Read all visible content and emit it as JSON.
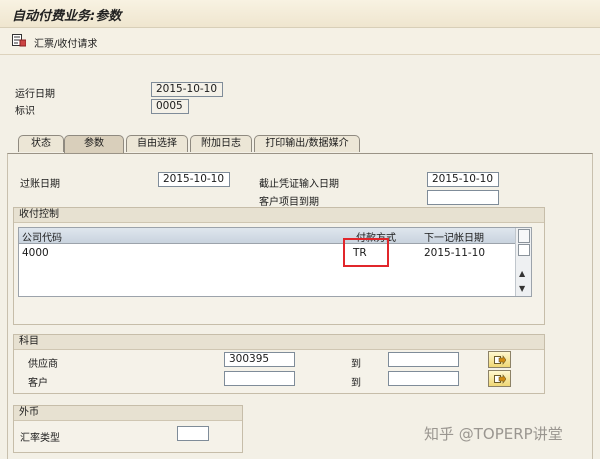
{
  "window": {
    "title": "自动付费业务:参数"
  },
  "toolbar": {
    "items": [
      {
        "icon": "document-list-icon",
        "label": "汇票/收付请求"
      }
    ]
  },
  "header": {
    "run_date_label": "运行日期",
    "run_date_value": "2015-10-10",
    "id_label": "标识",
    "id_value": "0005"
  },
  "tabs": [
    {
      "label": "状态",
      "active": false
    },
    {
      "label": "参数",
      "active": true
    },
    {
      "label": "自由选择",
      "active": false
    },
    {
      "label": "附加日志",
      "active": false
    },
    {
      "label": "打印输出/数据媒介",
      "active": false
    }
  ],
  "params": {
    "posting_date_label": "过账日期",
    "posting_date_value": "2015-10-10",
    "cutoff_label": "截止凭证输入日期",
    "cutoff_value": "2015-10-10",
    "customer_due_label": "客户项目到期",
    "customer_due_value": ""
  },
  "payment_control": {
    "title": "收付控制",
    "columns": [
      "公司代码",
      "付款方式",
      "下一记帐日期"
    ],
    "rows": [
      {
        "company": "4000",
        "method": "TR",
        "next_date": "2015-11-10"
      }
    ]
  },
  "accounts": {
    "title": "科目",
    "vendor_label": "供应商",
    "vendor_from": "300395",
    "vendor_to_label": "到",
    "vendor_to": "",
    "customer_label": "客户",
    "customer_from": "",
    "customer_to_label": "到",
    "customer_to": ""
  },
  "currency": {
    "title": "外币",
    "rate_type_label": "汇率类型",
    "rate_type_value": ""
  },
  "watermark": "知乎 @TOPERP讲堂",
  "colors": {
    "highlight_box": "#e1262b",
    "title_bg": "#f8f2e2"
  }
}
